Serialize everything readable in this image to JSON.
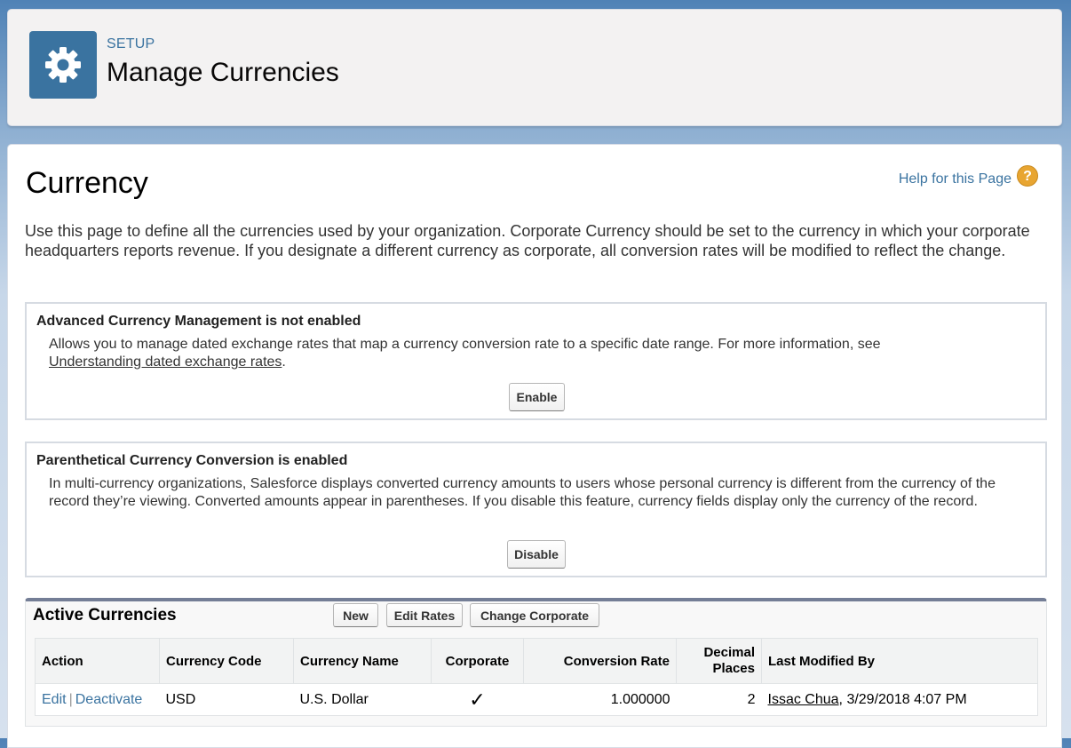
{
  "header": {
    "eyebrow": "SETUP",
    "title": "Manage Currencies"
  },
  "page": {
    "title": "Currency",
    "help_link": "Help for this Page",
    "help_icon": "?",
    "intro": "Use this page to define all the currencies used by your organization. Corporate Currency should be set to the currency in which your corporate headquarters reports revenue. If you designate a different currency as corporate, all conversion rates will be modified to reflect the change."
  },
  "advanced": {
    "title": "Advanced Currency Management is not enabled",
    "desc": "Allows you to manage dated exchange rates that map a currency conversion rate to a specific date range. For more information, see",
    "link": "Understanding dated exchange rates",
    "period": ".",
    "button": "Enable"
  },
  "parenthetical": {
    "title": "Parenthetical Currency Conversion is enabled",
    "desc": "In multi-currency organizations, Salesforce displays converted currency amounts to users whose personal currency is different from the currency of the record they’re viewing. Converted amounts appear in parentheses. If you disable this feature, currency fields display only the currency of the record.",
    "button": "Disable"
  },
  "active": {
    "title": "Active Currencies",
    "buttons": {
      "new": "New",
      "edit_rates": "Edit Rates",
      "change_corporate": "Change Corporate"
    },
    "columns": {
      "action": "Action",
      "code": "Currency Code",
      "name": "Currency Name",
      "corporate": "Corporate",
      "rate": "Conversion Rate",
      "decimal_1": "Decimal",
      "decimal_2": "Places",
      "modified": "Last Modified By"
    },
    "rows": [
      {
        "edit": "Edit",
        "sep": "|",
        "deactivate": "Deactivate",
        "code": "USD",
        "name": "U.S. Dollar",
        "corporate": "✓",
        "rate": "1.000000",
        "decimal": "2",
        "modified_user": "Issac Chua",
        "modified_date": ", 3/29/2018 4:07 PM"
      }
    ]
  },
  "colors": {
    "accent": "#3a73a0",
    "help_icon": "#e8a531",
    "list_border": "#747e96"
  },
  "icons": {
    "setup": "gear-icon",
    "help": "help-icon",
    "corporate": "checkmark-icon"
  }
}
